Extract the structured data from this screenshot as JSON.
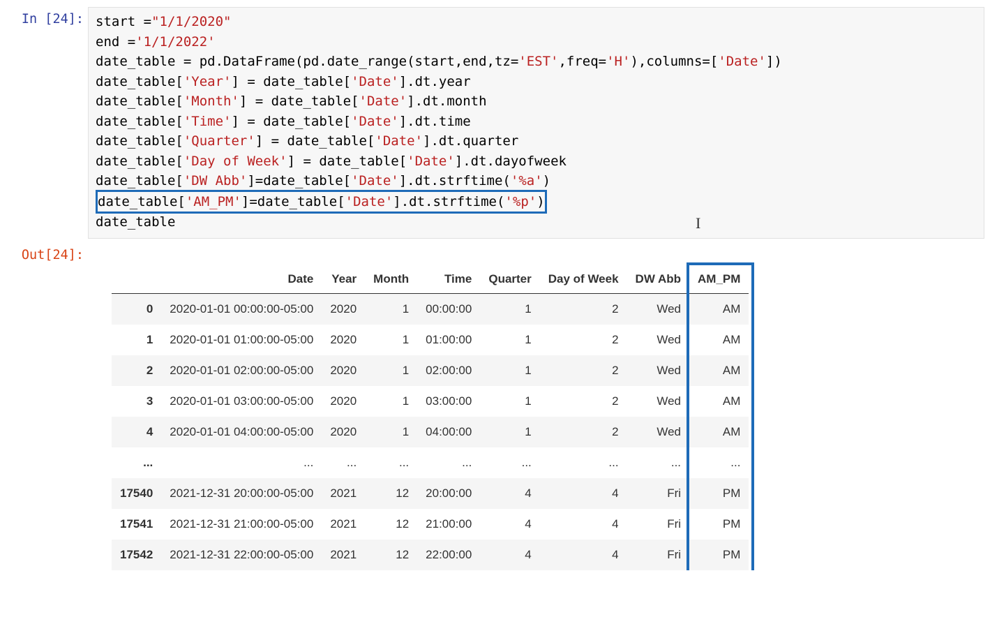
{
  "in_prompt": "In [24]:",
  "out_prompt": "Out[24]:",
  "code": {
    "l1_a": "start =",
    "l1_b": "\"1/1/2020\"",
    "l2_a": "end =",
    "l2_b": "'1/1/2022'",
    "l3_a": "date_table = pd.DataFrame(pd.date_range(start,end,tz=",
    "l3_b": "'EST'",
    "l3_c": ",freq=",
    "l3_d": "'H'",
    "l3_e": "),columns=[",
    "l3_f": "'Date'",
    "l3_g": "])",
    "l4_a": "date_table[",
    "l4_b": "'Year'",
    "l4_c": "] = date_table[",
    "l4_d": "'Date'",
    "l4_e": "].dt.year",
    "l5_a": "date_table[",
    "l5_b": "'Month'",
    "l5_c": "] = date_table[",
    "l5_d": "'Date'",
    "l5_e": "].dt.month",
    "l6_a": "date_table[",
    "l6_b": "'Time'",
    "l6_c": "] = date_table[",
    "l6_d": "'Date'",
    "l6_e": "].dt.time",
    "l7_a": "date_table[",
    "l7_b": "'Quarter'",
    "l7_c": "] = date_table[",
    "l7_d": "'Date'",
    "l7_e": "].dt.quarter",
    "l8_a": "date_table[",
    "l8_b": "'Day of Week'",
    "l8_c": "] = date_table[",
    "l8_d": "'Date'",
    "l8_e": "].dt.dayofweek",
    "l9_a": "date_table[",
    "l9_b": "'DW Abb'",
    "l9_c": "]=date_table[",
    "l9_d": "'Date'",
    "l9_e": "].dt.strftime(",
    "l9_f": "'%a'",
    "l9_g": ")",
    "l10_a": "date_table[",
    "l10_b": "'AM_PM'",
    "l10_c": "]=date_table[",
    "l10_d": "'Date'",
    "l10_e": "].dt.strftime(",
    "l10_f": "'%p'",
    "l10_g": ")",
    "l11": "date_table"
  },
  "table": {
    "headers": [
      "",
      "Date",
      "Year",
      "Month",
      "Time",
      "Quarter",
      "Day of Week",
      "DW Abb",
      "AM_PM"
    ],
    "rows": [
      [
        "0",
        "2020-01-01 00:00:00-05:00",
        "2020",
        "1",
        "00:00:00",
        "1",
        "2",
        "Wed",
        "AM"
      ],
      [
        "1",
        "2020-01-01 01:00:00-05:00",
        "2020",
        "1",
        "01:00:00",
        "1",
        "2",
        "Wed",
        "AM"
      ],
      [
        "2",
        "2020-01-01 02:00:00-05:00",
        "2020",
        "1",
        "02:00:00",
        "1",
        "2",
        "Wed",
        "AM"
      ],
      [
        "3",
        "2020-01-01 03:00:00-05:00",
        "2020",
        "1",
        "03:00:00",
        "1",
        "2",
        "Wed",
        "AM"
      ],
      [
        "4",
        "2020-01-01 04:00:00-05:00",
        "2020",
        "1",
        "04:00:00",
        "1",
        "2",
        "Wed",
        "AM"
      ],
      [
        "...",
        "...",
        "...",
        "...",
        "...",
        "...",
        "...",
        "...",
        "..."
      ],
      [
        "17540",
        "2021-12-31 20:00:00-05:00",
        "2021",
        "12",
        "20:00:00",
        "4",
        "4",
        "Fri",
        "PM"
      ],
      [
        "17541",
        "2021-12-31 21:00:00-05:00",
        "2021",
        "12",
        "21:00:00",
        "4",
        "4",
        "Fri",
        "PM"
      ],
      [
        "17542",
        "2021-12-31 22:00:00-05:00",
        "2021",
        "12",
        "22:00:00",
        "4",
        "4",
        "Fri",
        "PM"
      ]
    ]
  }
}
